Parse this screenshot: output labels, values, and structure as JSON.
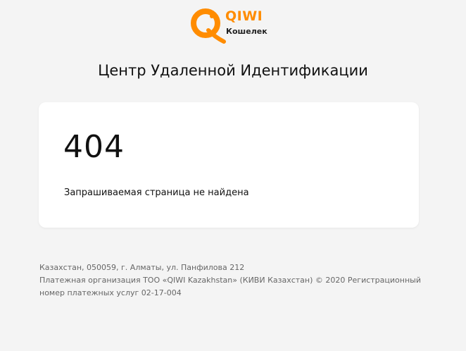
{
  "logo": {
    "brand": "QIWI",
    "subtitle": "Кошелек",
    "icon": "qiwi-logo-icon",
    "color": "#ff8c00"
  },
  "page_title": "Центр Удаленной Идентификации",
  "error": {
    "code": "404",
    "message": "Запрашиваемая страница не найдена"
  },
  "footer": {
    "address": "Казахстан, 050059, г. Алматы, ул. Панфилова 212",
    "line2": "Платежная организация ТОО «QIWI Kazakhstan» (КИВИ Казахстан) © 2020 Регистрационный",
    "line3": "номер платежных услуг 02-17-004"
  }
}
